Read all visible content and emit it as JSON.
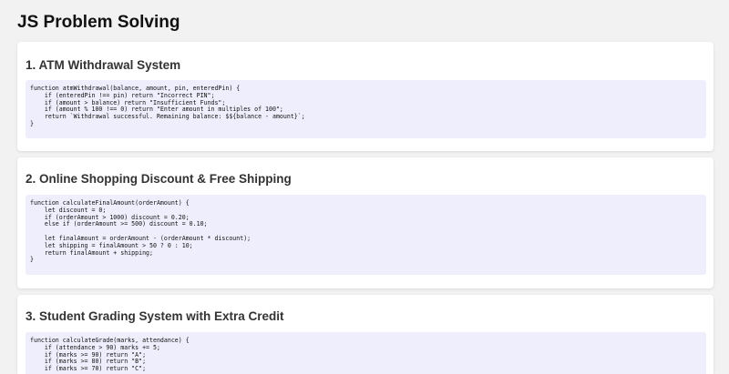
{
  "page": {
    "title": "JS Problem Solving"
  },
  "sections": [
    {
      "title": "1. ATM Withdrawal System",
      "code_lines": [
        "function atmWithdrawal(balance, amount, pin, enteredPin) {",
        "    if (enteredPin !== pin) return \"Incorrect PIN\";",
        "    if (amount > balance) return \"Insufficient Funds\";",
        "    if (amount % 100 !== 0) return \"Enter amount in multiples of 100\";",
        "    return `Withdrawal successful. Remaining balance: $${balance - amount}`;",
        "}"
      ]
    },
    {
      "title": "2. Online Shopping Discount & Free Shipping",
      "code_lines": [
        "function calculateFinalAmount(orderAmount) {",
        "    let discount = 0;",
        "    if (orderAmount > 1000) discount = 0.20;",
        "    else if (orderAmount >= 500) discount = 0.10;",
        "",
        "    let finalAmount = orderAmount - (orderAmount * discount);",
        "    let shipping = finalAmount > 50 ? 0 : 10;",
        "    return finalAmount + shipping;",
        "}"
      ]
    },
    {
      "title": "3. Student Grading System with Extra Credit",
      "code_lines": [
        "function calculateGrade(marks, attendance) {",
        "    if (attendance > 90) marks += 5;",
        "    if (marks >= 90) return \"A\";",
        "    if (marks >= 80) return \"B\";",
        "    if (marks >= 70) return \"C\";"
      ]
    }
  ]
}
